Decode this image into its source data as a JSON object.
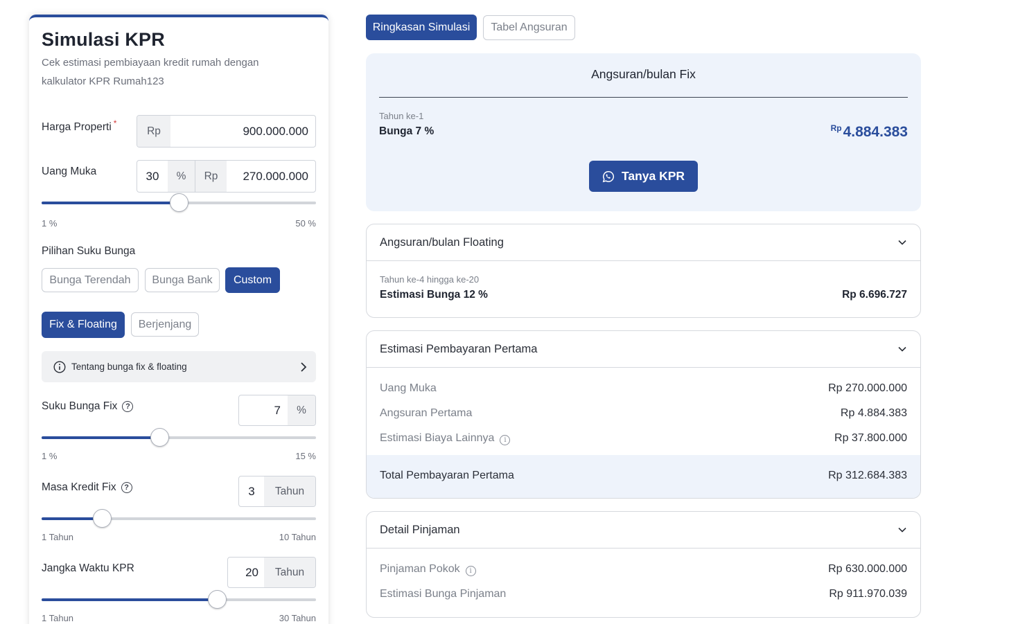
{
  "left": {
    "title": "Simulasi KPR",
    "subtitle": "Cek estimasi pembiayaan kredit rumah dengan kalkulator KPR Rumah123",
    "harga": {
      "label": "Harga Properti",
      "required_mark": "*",
      "prefix": "Rp",
      "value": "900.000.000"
    },
    "uang_muka": {
      "label": "Uang Muka",
      "percent_value": "30",
      "percent_unit": "%",
      "prefix": "Rp",
      "value": "270.000.000",
      "slider_fraction": 0.5,
      "min_label": "1 %",
      "max_label": "50 %"
    },
    "suku_bunga": {
      "label": "Pilihan Suku Bunga",
      "options": [
        "Bunga Terendah",
        "Bunga Bank",
        "Custom"
      ],
      "selected": "Custom"
    },
    "skema": {
      "options": [
        "Fix & Floating",
        "Berjenjang"
      ],
      "selected": "Fix & Floating"
    },
    "info": {
      "text": "Tentang bunga fix & floating"
    },
    "bunga_fix": {
      "label": "Suku Bunga Fix",
      "value": "7",
      "unit": "%",
      "slider_fraction": 0.43,
      "min_label": "1 %",
      "max_label": "15 %"
    },
    "masa_fix": {
      "label": "Masa Kredit Fix",
      "value": "3",
      "unit": "Tahun",
      "slider_fraction": 0.22,
      "min_label": "1 Tahun",
      "max_label": "10 Tahun"
    },
    "jangka_waktu": {
      "label": "Jangka Waktu KPR",
      "value": "20",
      "unit": "Tahun",
      "slider_fraction": 0.64,
      "min_label": "1 Tahun",
      "max_label": "30 Tahun"
    }
  },
  "tabs": [
    {
      "label": "Ringkasan Simulasi",
      "active": true
    },
    {
      "label": "Tabel Angsuran",
      "active": false
    }
  ],
  "fix": {
    "title": "Angsuran/bulan Fix",
    "year_label": "Tahun ke-1",
    "rate_label": "Bunga 7 %",
    "amount_prefix": "Rp",
    "amount": "4.884.383",
    "cta_label": "Tanya KPR"
  },
  "floating": {
    "title": "Angsuran/bulan Floating",
    "year_label": "Tahun ke-4 hingga ke-20",
    "rate_label": "Estimasi Bunga 12 %",
    "amount": "Rp 6.696.727"
  },
  "pembayaran_pertama": {
    "title": "Estimasi Pembayaran Pertama",
    "rows": [
      {
        "label": "Uang Muka",
        "value": "Rp 270.000.000"
      },
      {
        "label": "Angsuran Pertama",
        "value": "Rp 4.884.383"
      },
      {
        "label": "Estimasi Biaya Lainnya",
        "value": "Rp 37.800.000"
      }
    ],
    "total_label": "Total Pembayaran Pertama",
    "total_value": "Rp 312.684.383"
  },
  "detail_pinjaman": {
    "title": "Detail Pinjaman",
    "rows": [
      {
        "label": "Pinjaman Pokok",
        "value": "Rp 630.000.000"
      },
      {
        "label": "Estimasi Bunga Pinjaman",
        "value": "Rp 911.970.039"
      }
    ]
  },
  "colors": {
    "primary": "#2a4d9c",
    "light_panel": "#eef3fb",
    "required": "#d23a3a"
  }
}
